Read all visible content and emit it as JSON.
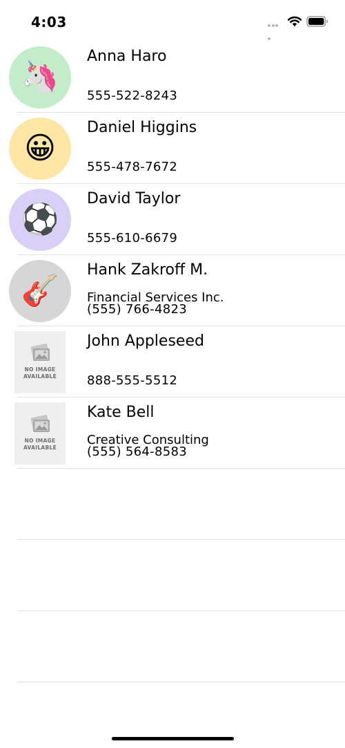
{
  "status_bar": {
    "time": "4:03"
  },
  "colors": {
    "separator": "#e2e2e2",
    "avatar_green": "#c3ecc8",
    "avatar_yellow": "#fde6a6",
    "avatar_purple": "#d8d0f6",
    "avatar_gray": "#d6d6d6",
    "no_image_bg": "#efefef"
  },
  "contacts": [
    {
      "name": "Anna Haro",
      "company": "",
      "phone": "555-522-8243",
      "avatar": "unicorn-icon",
      "avatar_glyph": "🦄",
      "no_image_label_1": "",
      "no_image_label_2": ""
    },
    {
      "name": "Daniel Higgins",
      "company": "",
      "phone": "555-478-7672",
      "avatar": "grinning-face-icon",
      "avatar_glyph": "😀",
      "no_image_label_1": "",
      "no_image_label_2": ""
    },
    {
      "name": "David Taylor",
      "company": "",
      "phone": "555-610-6679",
      "avatar": "soccer-ball-icon",
      "avatar_glyph": "⚽",
      "no_image_label_1": "",
      "no_image_label_2": ""
    },
    {
      "name": "Hank Zakroff M.",
      "company": "Financial Services Inc.",
      "phone": "(555) 766-4823",
      "avatar": "guitar-icon",
      "avatar_glyph": "🎸",
      "no_image_label_1": "",
      "no_image_label_2": ""
    },
    {
      "name": "John Appleseed",
      "company": "",
      "phone": "888-555-5512",
      "avatar": "no-image-placeholder",
      "avatar_glyph": "",
      "no_image_label_1": "NO IMAGE",
      "no_image_label_2": "AVAILABLE"
    },
    {
      "name": "Kate Bell",
      "company": "Creative Consulting",
      "phone": "(555) 564-8583",
      "avatar": "no-image-placeholder",
      "avatar_glyph": "",
      "no_image_label_1": "NO IMAGE",
      "no_image_label_2": "AVAILABLE"
    }
  ]
}
